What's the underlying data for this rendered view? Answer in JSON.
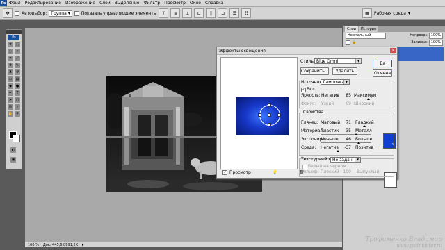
{
  "app": {
    "logo": "Ps"
  },
  "menu": [
    "Файл",
    "Редактирование",
    "Изображение",
    "Слой",
    "Выделение",
    "Фильтр",
    "Просмотр",
    "Окно",
    "Справка"
  ],
  "workspace": {
    "label": "Рабочая среда"
  },
  "options_bar": {
    "autoselect_label": "Автовыбор:",
    "autoselect_value": "Группа",
    "show_controls_label": "Показать управляющие элементы"
  },
  "status_bar": {
    "zoom": "100 %",
    "doc_info": "Док: 445,6K/891,2K"
  },
  "panels": {
    "tabs": [
      "Слои",
      "История"
    ],
    "blend_mode": "Нормальный",
    "opacity_label": "Непрозр.:",
    "opacity_value": "100%",
    "fill_label": "Заливка:",
    "fill_value": "100%"
  },
  "dialog": {
    "title": "Эффекты освещения",
    "preview_label": "Просмотр",
    "style_label": "Стиль:",
    "style_value": "Blue Omni",
    "ok_label": "Да",
    "cancel_label": "Отмена",
    "save_label": "Сохранить...",
    "delete_label": "Удалить",
    "light_source": {
      "label": "Источник:",
      "type": "Лампочка",
      "on_label": "Вкл",
      "intensity": {
        "label": "Яркость:",
        "min": "Негатив",
        "value": "85",
        "max": "Максимум"
      },
      "focus": {
        "label": "Фокус:",
        "min": "Узкий",
        "value": "69",
        "max": "Широкий"
      },
      "color": "#0f3fd0"
    },
    "properties": {
      "label": "Свойства",
      "gloss": {
        "label": "Глянец:",
        "min": "Матовый",
        "value": "71",
        "max": "Гладкий"
      },
      "material": {
        "label": "Материал:",
        "min": "Пластик",
        "value": "35",
        "max": "Металл"
      },
      "exposure": {
        "label": "Экспонир.:",
        "min": "Меньше",
        "value": "46",
        "max": "Больше"
      },
      "ambience": {
        "label": "Среда:",
        "min": "Негатив",
        "value": "-37",
        "max": "Позитив"
      },
      "color": "#ffffff"
    },
    "texture": {
      "label": "Текстурный канал:",
      "value": "Не задан",
      "white_high": "Белый на черном",
      "height_label": "Рельеф:",
      "height_min": "Плоский",
      "height_value": "100",
      "height_max": "Выпуклый"
    }
  },
  "watermark": {
    "line1": "Трофименко Владимир",
    "line2": "www.psdmaster.ru"
  }
}
